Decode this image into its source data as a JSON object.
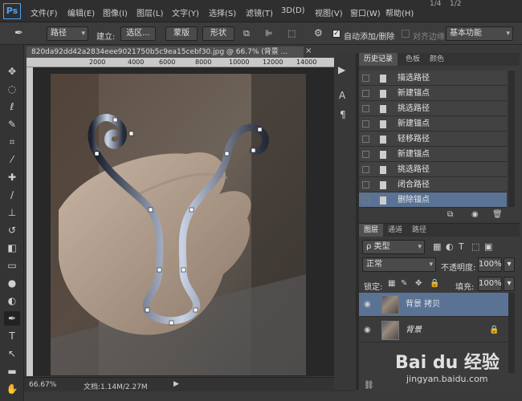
{
  "menubar": {
    "logo": "Ps",
    "items": [
      "文件(F)",
      "编辑(E)",
      "图像(I)",
      "图层(L)",
      "文字(Y)",
      "选择(S)",
      "滤镜(T)",
      "3D(D)",
      "视图(V)",
      "窗口(W)",
      "帮助(H)"
    ],
    "right_icons": [
      "1/4",
      "1/2"
    ]
  },
  "options": {
    "mode_select": "路径",
    "build_label": "建立:",
    "selection_btn": "选区...",
    "mask_btn": "蒙版",
    "shape_btn": "形状",
    "auto_add_delete": "自动添加/删除",
    "align_edges": "对齐边缘",
    "workspace": "基本功能"
  },
  "document": {
    "tab_title": "820da92dd42a2834eee9021750b5c9ea15cebf30.jpg @ 66.7% (背景 ...",
    "ruler_ticks": [
      "2000",
      "4000",
      "6000",
      "8000",
      "10000",
      "12000",
      "14000"
    ],
    "zoom": "66.67%",
    "doc_info": "文档:1.14M/2.27M"
  },
  "history_panel": {
    "tabs": [
      "历史记录",
      "色板",
      "颜色"
    ],
    "rows": [
      "描选路径",
      "新建锚点",
      "挑选路径",
      "新建锚点",
      "轻移路径",
      "新建锚点",
      "挑选路径",
      "闭合路径",
      "删除锚点"
    ],
    "selected_index": 8
  },
  "layers_panel": {
    "tabs": [
      "图层",
      "通道",
      "路径"
    ],
    "filter_kind": "ρ 类型",
    "blend_mode": "正常",
    "opacity_label": "不透明度:",
    "opacity_value": "100%",
    "lock_label": "锁定:",
    "fill_label": "填充:",
    "fill_value": "100%",
    "layers": [
      {
        "name": "背景 拷贝",
        "selected": true
      },
      {
        "name": "背景",
        "selected": false
      }
    ]
  },
  "watermark": {
    "brand": "Bai du 经验",
    "url": "jingyan.baidu.com"
  }
}
